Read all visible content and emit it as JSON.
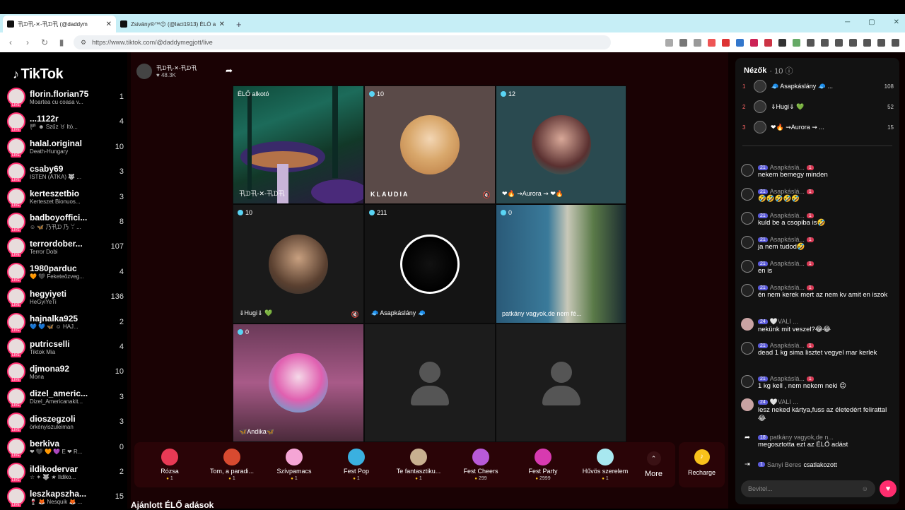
{
  "browser": {
    "tabs": [
      {
        "title": "卂ᗪ卂-✕-卂ᗪ卂 (@daddym"
      },
      {
        "title": "Zsivány®™😐 (@laci1913) ÉLŐ a"
      }
    ],
    "url": "https://www.tiktok.com/@daddymegjott/live"
  },
  "sidebar": {
    "logo": "TikTok",
    "accounts": [
      {
        "name": "florin.florian75",
        "sub": "Moartea cu coasa v...",
        "count": "1"
      },
      {
        "name": "...1122r",
        "sub": "🏴 ☻ Szűz ♉ Itó...",
        "count": "4"
      },
      {
        "name": "halal.original",
        "sub": "Death-Hungary",
        "count": "10"
      },
      {
        "name": "csaby69",
        "sub": "ISTEN (ÁTKA) 🐺 ...",
        "count": "3"
      },
      {
        "name": "kerteszetbio",
        "sub": "Kerteszet Bionuos...",
        "count": "3"
      },
      {
        "name": "badboyoffici...",
        "sub": "☺ 🦋 乃卂ᗪ 乃 ꌩ ...",
        "count": "8"
      },
      {
        "name": "terrordober...",
        "sub": "Terror Dobi",
        "count": "107"
      },
      {
        "name": "1980parduc",
        "sub": "🧡 🖤 Feketeözveg...",
        "count": "4"
      },
      {
        "name": "hegyiyeti",
        "sub": "HeGyiYeTi",
        "count": "136"
      },
      {
        "name": "hajnalka925",
        "sub": "💙 💙 🦋 ☺ HAJ...",
        "count": "2"
      },
      {
        "name": "putricselli",
        "sub": "Tiktok Mia",
        "count": "4"
      },
      {
        "name": "djmona92",
        "sub": "Mona",
        "count": "10"
      },
      {
        "name": "dizel_americ...",
        "sub": "Dizel_Americanakit...",
        "count": "3"
      },
      {
        "name": "dioszegzoli",
        "sub": "örkényiszuleiman",
        "count": "3"
      },
      {
        "name": "berkiva",
        "sub": "❤ 🖤 🧡 💜 E ❤ R...",
        "count": "0"
      },
      {
        "name": "ildikodervar",
        "sub": "☆ ✶ 🐺 ★ Ildiko...",
        "count": "2"
      },
      {
        "name": "leszkapszha...",
        "sub": "🍷 🦊 Nesquik 🦊 ...",
        "count": "15"
      }
    ]
  },
  "host": {
    "name": "卂ᗪ卂-✕-卂ᗪ卂",
    "likes": "48.3K"
  },
  "stream": {
    "cells": [
      {
        "badge": "ÉLŐ alkotó",
        "name": "卂ᗪ卂-✕-卂ᗪ卂"
      },
      {
        "badge": "10",
        "name": "KLAUDIA"
      },
      {
        "badge": "12",
        "name": "❤🔥 ⇝Aurora ⇝ ❤🔥"
      },
      {
        "badge": "10",
        "name": "⇓Hugi⇓ 💚"
      },
      {
        "badge": "211",
        "name": "🧢 Asapkáslány 🧢"
      },
      {
        "badge": "0",
        "name": "patkány vagyok,de nem fé..."
      },
      {
        "badge": "0",
        "name": "🦋Andika🦋"
      },
      {
        "badge": "",
        "name": ""
      },
      {
        "badge": "",
        "name": ""
      }
    ]
  },
  "gifts": [
    {
      "name": "Rózsa",
      "price": "1",
      "color": "#e83a55"
    },
    {
      "name": "Tom, a paradi...",
      "price": "1",
      "color": "#d84a30"
    },
    {
      "name": "Szívpamacs",
      "price": "1",
      "color": "#f5a5d5"
    },
    {
      "name": "Fest Pop",
      "price": "1",
      "color": "#3ab0e0"
    },
    {
      "name": "Te fantasztiku...",
      "price": "1",
      "color": "#c8b090"
    },
    {
      "name": "Fest Cheers",
      "price": "299",
      "color": "#b85ad8"
    },
    {
      "name": "Fest Party",
      "price": "2999",
      "color": "#d83ab0"
    },
    {
      "name": "Hűvös szerelem",
      "price": "1",
      "color": "#a8e8f0"
    }
  ],
  "more_label": "More",
  "recharge_label": "Recharge",
  "recommended_label": "Ajánlott ÉLŐ adások",
  "chat": {
    "header": "Nézők",
    "viewer_count": "10",
    "top_viewers": [
      {
        "rank": "1",
        "name": "🧢 Asapkáslány 🧢 ...",
        "score": "108"
      },
      {
        "rank": "2",
        "name": "⇓Hugi⇓ 💚",
        "score": "52"
      },
      {
        "rank": "3",
        "name": "❤🔥 ⇝Aurora ⇝ ...",
        "score": "15"
      }
    ],
    "messages": [
      {
        "level": "21",
        "user": "Asapkáslá...",
        "fan": "1",
        "text": "nekem bemegy minden"
      },
      {
        "level": "21",
        "user": "Asapkáslá...",
        "fan": "1",
        "text": "🤣🤣🤣🤣🤣"
      },
      {
        "level": "21",
        "user": "Asapkáslá...",
        "fan": "1",
        "text": "kuld be a csopiba is🤣"
      },
      {
        "level": "21",
        "user": "Asapkáslá...",
        "fan": "1",
        "text": "ja nem tudod🤣"
      },
      {
        "level": "21",
        "user": "Asapkáslá...",
        "fan": "1",
        "text": "en is"
      },
      {
        "level": "21",
        "user": "Asapkáslá...",
        "fan": "1",
        "text": "én nem kerek mert az nem kv amit en iszok"
      },
      {
        "level": "24",
        "user": "🤍VALI ...",
        "fan": "",
        "text": "nekünk mit veszel?😂😂"
      },
      {
        "level": "21",
        "user": "Asapkáslá...",
        "fan": "1",
        "text": "dead 1 kg sima lisztet vegyel mar kerlek"
      },
      {
        "level": "21",
        "user": "Asapkáslá...",
        "fan": "1",
        "text": "1 kg kell , nem nekem neki 😉"
      },
      {
        "level": "24",
        "user": "🤍VALI ...",
        "fan": "",
        "text": "lesz neked kártya,fuss az életedért felirattal 😂"
      }
    ],
    "share_event": {
      "level": "18",
      "user": "patkány vagyok,de n...",
      "text": "megosztotta ezt az ÉLŐ adást"
    },
    "join_event": {
      "level": "1",
      "user": "Sanyi Beres",
      "text": "csatlakozott"
    },
    "input_placeholder": "Bevitel..."
  }
}
